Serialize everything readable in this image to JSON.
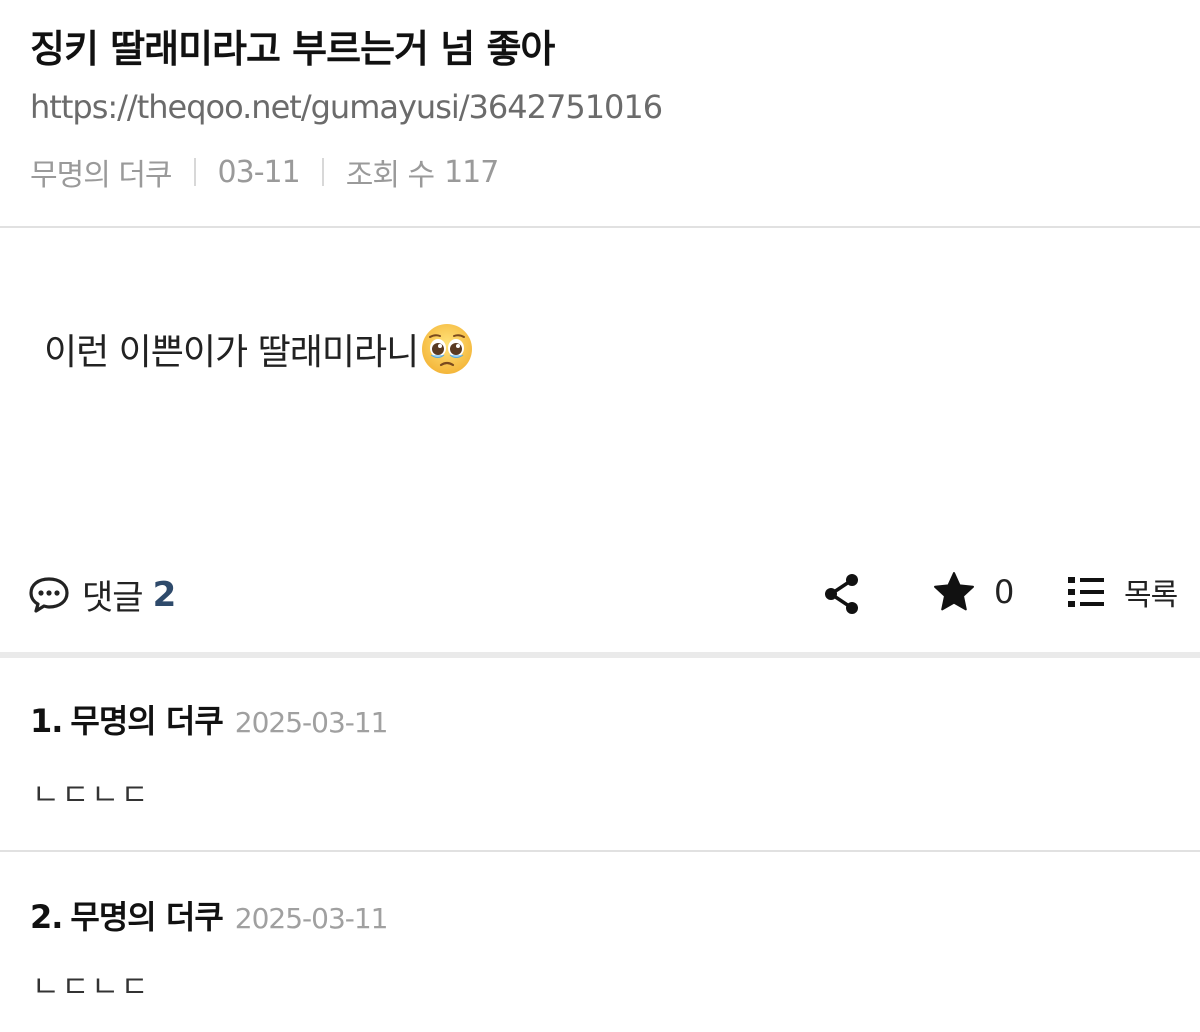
{
  "post": {
    "title": "징키 딸래미라고 부르는거 넘 좋아",
    "url": "https://theqoo.net/gumayusi/3642751016",
    "author": "무명의 더쿠",
    "date": "03-11",
    "views_label": "조회 수",
    "views_value": "117",
    "body": "이런 이쁜이가 딸래미라니",
    "body_emoji": "pleading-face-emoji"
  },
  "actions": {
    "comment_label": "댓글",
    "comment_count": "2",
    "favorite_count": "0",
    "list_label": "목록"
  },
  "comments": [
    {
      "number": "1.",
      "author": "무명의 더쿠",
      "date": "2025-03-11",
      "text": "ㄴㄷㄴㄷ"
    },
    {
      "number": "2.",
      "author": "무명의 더쿠",
      "date": "2025-03-11",
      "text": "ㄴㄷㄴㄷ"
    }
  ],
  "icons": {
    "comment": "speech-bubble-icon",
    "share": "share-icon",
    "favorite": "star-icon",
    "list": "list-icon"
  },
  "colors": {
    "comment_count": "#2e4a6b",
    "meta_text": "#9a9a9a",
    "divider": "#e1e1e1"
  }
}
